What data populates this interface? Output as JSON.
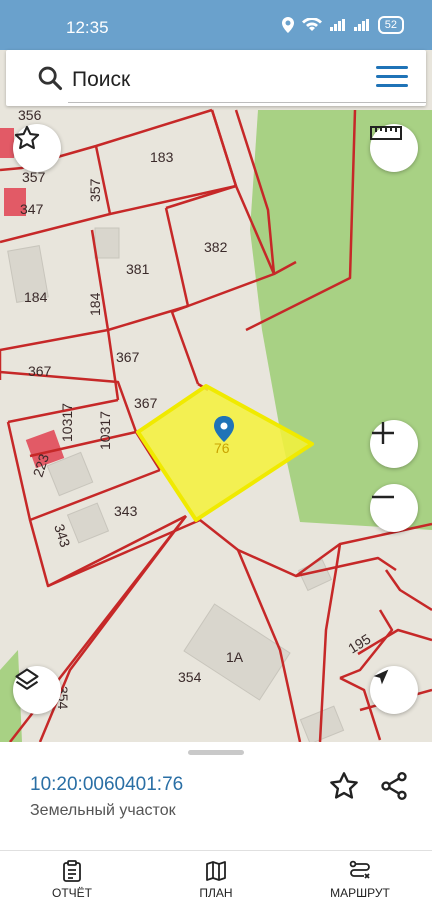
{
  "status_bar": {
    "time": "12:35",
    "battery": "52"
  },
  "search": {
    "placeholder": "Поиск"
  },
  "map": {
    "plot_labels": [
      "356",
      "357",
      "347",
      "183",
      "357",
      "382",
      "381",
      "184",
      "184",
      "367",
      "367",
      "367",
      "10317",
      "10317",
      "223",
      "343",
      "343",
      "76",
      "195",
      "1А",
      "354",
      "354"
    ],
    "selected_plot": "76",
    "colors": {
      "boundary": "#c62828",
      "selected_fill": "#f4f23a",
      "forest": "#a5cf7f",
      "pin": "#1f73b7"
    }
  },
  "controls": {
    "favorite": "star-icon",
    "ruler": "ruler-icon",
    "zoom_in": "plus-icon",
    "zoom_out": "minus-icon",
    "layers": "layers-icon",
    "locate": "navigation-icon"
  },
  "sheet": {
    "cadastral_number": "10:20:0060401:76",
    "type": "Земельный участок"
  },
  "nav": [
    {
      "label": "ОТЧЁТ",
      "icon": "report-icon"
    },
    {
      "label": "ПЛАН",
      "icon": "map-icon"
    },
    {
      "label": "МАРШРУТ",
      "icon": "route-icon"
    }
  ]
}
